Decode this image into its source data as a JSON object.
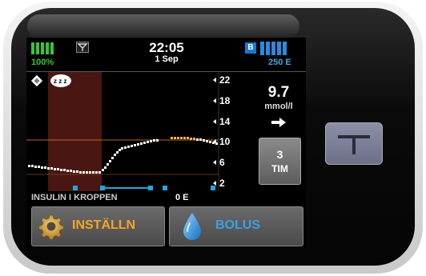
{
  "status_bar": {
    "battery_percent": "100%",
    "time": "22:05",
    "date": "1 Sep",
    "badge": "B",
    "insulin_remaining": "250 E"
  },
  "graph": {
    "y_ticks": [
      "22",
      "18",
      "14",
      "10",
      "6",
      "2"
    ],
    "icons": [
      "cgm-diamond-icon",
      "sleep-zzz-icon"
    ],
    "target_high": 10,
    "target_low": 3.9
  },
  "side_panel": {
    "bg_value": "9.7",
    "bg_unit": "mmol/l",
    "trend_icon": "arrow-right-icon",
    "hours_value": "3",
    "hours_unit": "TIM"
  },
  "iob": {
    "label": "INSULIN I KROPPEN",
    "value": "0 E"
  },
  "buttons": {
    "settings_label": "INSTÄLLN",
    "bolus_label": "BOLUS"
  },
  "colors": {
    "battery": "#39c33a",
    "insulin": "#2a8be0",
    "settings_text": "#f5a623",
    "bolus_text": "#3aa0e6",
    "high_line": "#c0651d",
    "sleep_zone": "#4a1612"
  }
}
